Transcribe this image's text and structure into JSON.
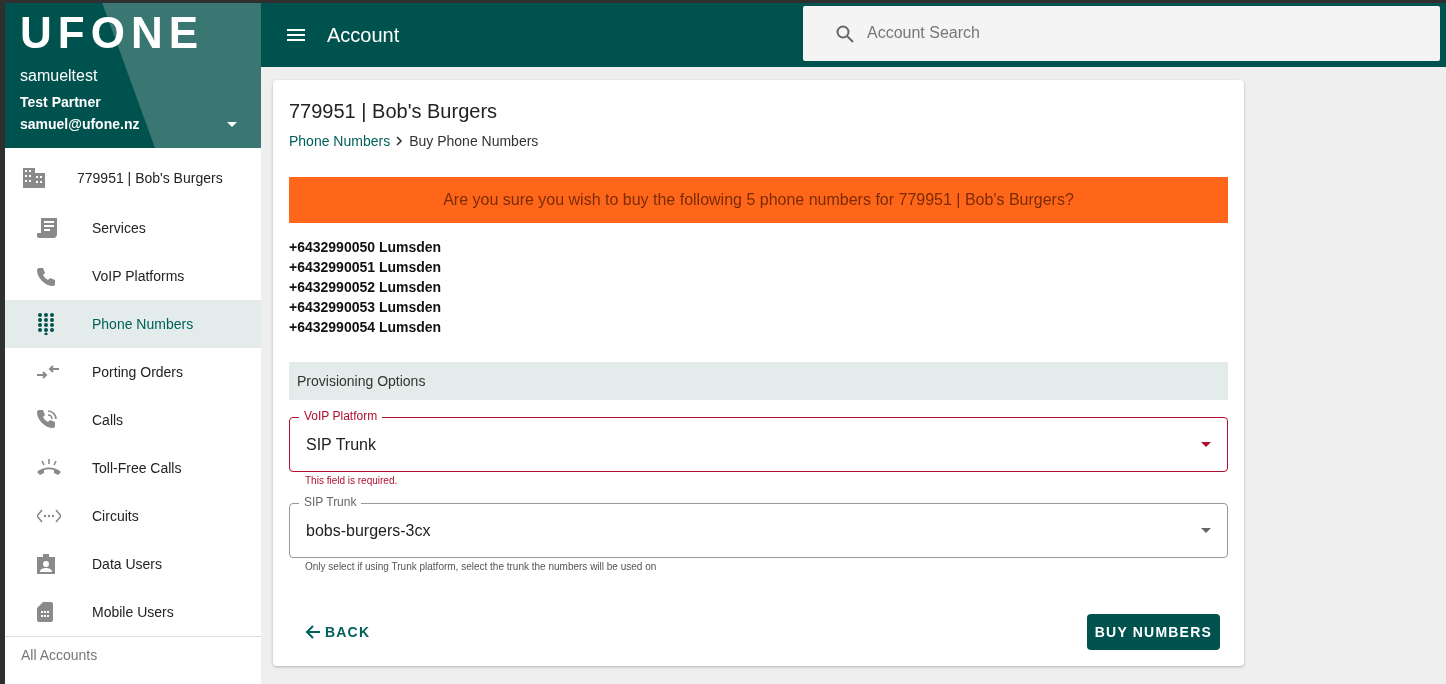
{
  "sidebar": {
    "logo": "UFONE",
    "user": {
      "name": "samueltest",
      "partner": "Test Partner",
      "email": "samuel@ufone.nz"
    },
    "account": {
      "label": "779951 | Bob's Burgers"
    },
    "items": [
      {
        "label": "Services",
        "kind": "receipt",
        "selected": false
      },
      {
        "label": "VoIP Platforms",
        "kind": "sip",
        "selected": false
      },
      {
        "label": "Phone Numbers",
        "kind": "dialpad",
        "selected": true
      },
      {
        "label": "Porting Orders",
        "kind": "swap",
        "selected": false
      },
      {
        "label": "Calls",
        "kind": "calls",
        "selected": false
      },
      {
        "label": "Toll-Free Calls",
        "kind": "ring",
        "selected": false
      },
      {
        "label": "Circuits",
        "kind": "code",
        "selected": false
      },
      {
        "label": "Data Users",
        "kind": "badge",
        "selected": false
      },
      {
        "label": "Mobile Users",
        "kind": "sim",
        "selected": false
      }
    ],
    "footer": "All Accounts"
  },
  "topbar": {
    "title": "Account",
    "search": {
      "placeholder": "Account Search"
    }
  },
  "card": {
    "title": "779951 | Bob's Burgers",
    "breadcrumb": [
      {
        "label": "Phone Numbers",
        "link": true
      },
      {
        "label": "Buy Phone Numbers",
        "link": false
      }
    ],
    "alert": "Are you sure you wish to buy the following 5 phone numbers for 779951 | Bob's Burgers?",
    "numbers": [
      "+6432990050 Lumsden",
      "+6432990051 Lumsden",
      "+6432990052 Lumsden",
      "+6432990053 Lumsden",
      "+6432990054 Lumsden"
    ],
    "section": "Provisioning Options",
    "fields": [
      {
        "label": "VoIP Platform",
        "value": "SIP Trunk",
        "helper": "This field is required.",
        "error": true
      },
      {
        "label": "SIP Trunk",
        "value": "bobs-burgers-3cx",
        "helper": "Only select if using Trunk platform, select the trunk the numbers will be used on",
        "error": false
      }
    ],
    "back": "BACK",
    "submit": "BUY NUMBERS"
  }
}
